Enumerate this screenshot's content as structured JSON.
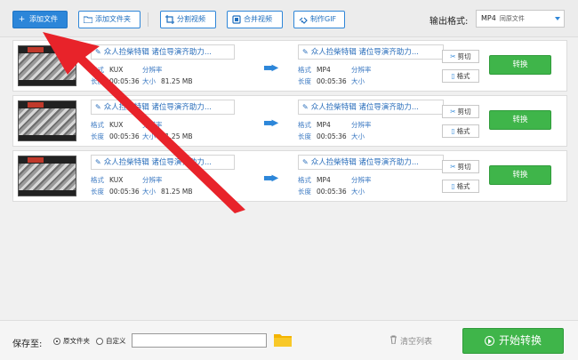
{
  "toolbar": {
    "add_file": "添加文件",
    "add_folder": "添加文件夹",
    "split_video": "分割视频",
    "merge_video": "合并视频",
    "make_gif": "制作GIF",
    "output_format_label": "输出格式:",
    "output_format_value": "MP4",
    "output_format_sub": "同原文件"
  },
  "files": [
    {
      "source_name": "众人捡柴特辑 诸位导演齐助力...",
      "format_key": "格式",
      "format_value": "KUX",
      "resolution_key": "分辨率",
      "duration_key": "长度",
      "duration_value": "00:05:36",
      "size_key": "大小",
      "size_value": "81.25 MB",
      "output_name": "众人捡柴特辑 诸位导演齐助力...",
      "out_format_key": "格式",
      "out_format_value": "MP4",
      "out_resolution_key": "分辨率",
      "out_duration_key": "长度",
      "out_duration_value": "00:05:36",
      "out_size_key": "大小"
    },
    {
      "source_name": "众人捡柴特辑 诸位导演齐助力...",
      "format_key": "格式",
      "format_value": "KUX",
      "resolution_key": "分辨率",
      "duration_key": "长度",
      "duration_value": "00:05:36",
      "size_key": "大小",
      "size_value": "81.25 MB",
      "output_name": "众人捡柴特辑 诸位导演齐助力...",
      "out_format_key": "格式",
      "out_format_value": "MP4",
      "out_resolution_key": "分辨率",
      "out_duration_key": "长度",
      "out_duration_value": "00:05:36",
      "out_size_key": "大小"
    },
    {
      "source_name": "众人捡柴特辑 诸位导演齐助力...",
      "format_key": "格式",
      "format_value": "KUX",
      "resolution_key": "分辨率",
      "duration_key": "长度",
      "duration_value": "00:05:36",
      "size_key": "大小",
      "size_value": "81.25 MB",
      "output_name": "众人捡柴特辑 诸位导演齐助力...",
      "out_format_key": "格式",
      "out_format_value": "MP4",
      "out_resolution_key": "分辨率",
      "out_duration_key": "长度",
      "out_duration_value": "00:05:36",
      "out_size_key": "大小"
    }
  ],
  "row_actions": {
    "cut": "剪切",
    "format": "格式",
    "convert": "转换"
  },
  "bottom": {
    "save_to": "保存至:",
    "option_original": "原文件夹",
    "option_custom": "自定义",
    "clear_list": "清空列表",
    "start_convert": "开始转换"
  },
  "colors": {
    "accent_blue": "#2c86d9",
    "convert_green": "#3fb54a",
    "annotation_red": "#e8232a"
  }
}
